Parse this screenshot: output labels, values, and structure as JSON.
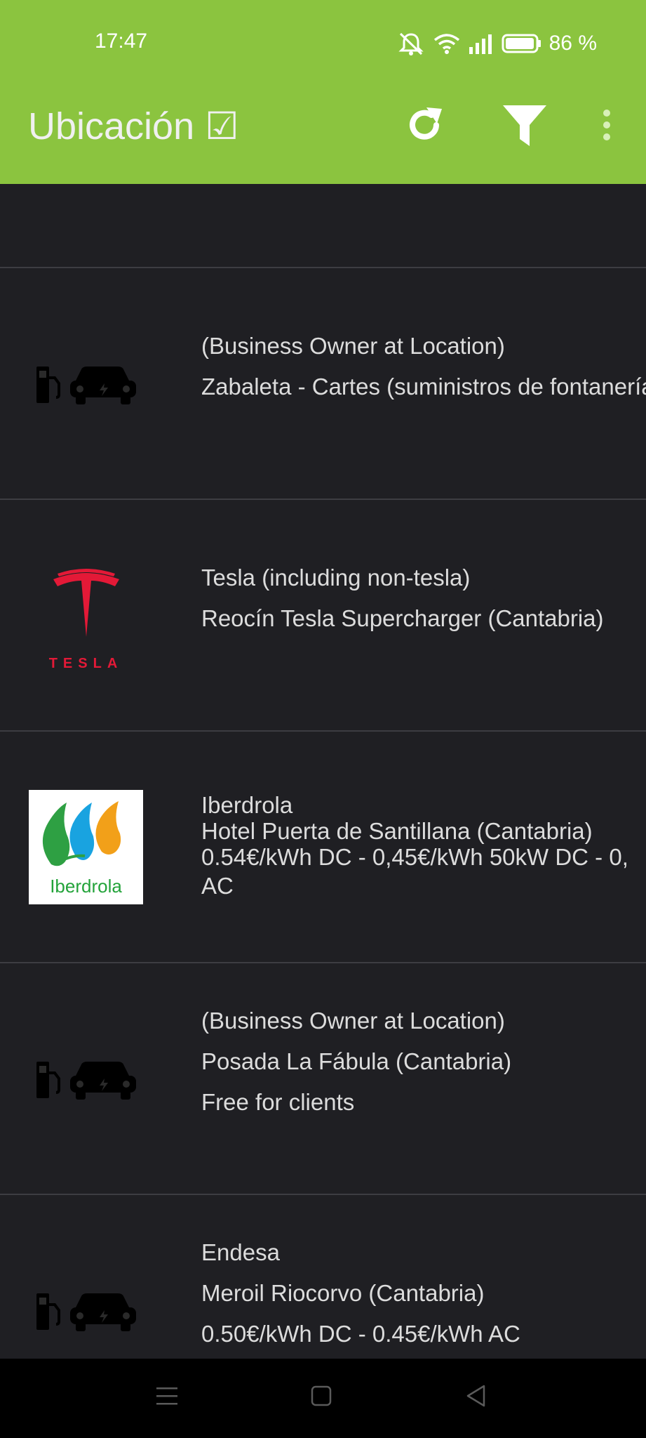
{
  "status_bar": {
    "time": "17:47",
    "battery_percent": "86 %",
    "icons": [
      "mute-icon",
      "wifi-icon",
      "signal-icon",
      "battery-icon"
    ]
  },
  "toolbar": {
    "title": "Ubicación ☑",
    "actions": [
      "refresh-icon",
      "filter-icon",
      "more-vert-icon"
    ]
  },
  "locations": [
    {
      "icon": "ev-charging-car-icon",
      "lines": [
        "(Business Owner at Location)",
        "Zabaleta - Cartes (suministros de fontanería)"
      ]
    },
    {
      "icon": "tesla-logo",
      "logo_text": "TESLA",
      "lines": [
        "Tesla (including non-tesla)",
        "Reocín Tesla Supercharger (Cantabria)"
      ]
    },
    {
      "icon": "iberdrola-logo",
      "logo_text": "Iberdrola",
      "lines": [
        "Iberdrola",
        "Hotel Puerta de Santillana (Cantabria)",
        "0.54€/kWh DC - 0,45€/kWh 50kW DC - 0,",
        "AC"
      ]
    },
    {
      "icon": "ev-charging-car-icon",
      "lines": [
        "(Business Owner at Location)",
        "Posada La Fábula (Cantabria)",
        "Free for clients"
      ]
    },
    {
      "icon": "ev-charging-car-icon",
      "lines": [
        "Endesa",
        "Meroil Riocorvo (Cantabria)",
        "0.50€/kWh DC - 0.45€/kWh AC"
      ]
    }
  ],
  "colors": {
    "toolbar": "#8bc43f",
    "background": "#1f1f23",
    "divider": "#3d3d42",
    "tesla_red": "#e31937",
    "iberdrola_green": "#23a33a"
  }
}
